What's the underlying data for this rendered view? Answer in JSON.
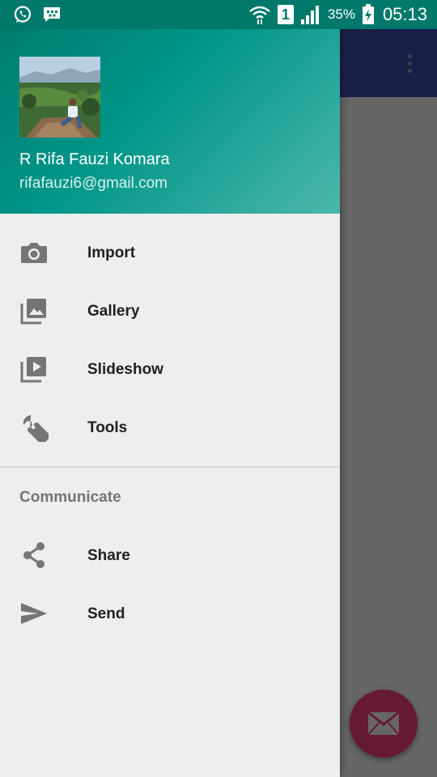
{
  "status_bar": {
    "battery_percent": "35%",
    "time": "05:13",
    "sim_slot": "1",
    "icons": [
      "whatsapp-icon",
      "bbm-icon",
      "wifi-icon",
      "sim-icon",
      "signal-icon",
      "battery-charging-icon"
    ]
  },
  "drawer": {
    "header": {
      "user_name": "R Rifa Fauzi Komara",
      "user_email": "rifafauzi6@gmail.com"
    },
    "items": [
      {
        "label": "Import",
        "icon": "camera-icon"
      },
      {
        "label": "Gallery",
        "icon": "gallery-icon"
      },
      {
        "label": "Slideshow",
        "icon": "slideshow-icon"
      },
      {
        "label": "Tools",
        "icon": "wrench-icon"
      }
    ],
    "section_title": "Communicate",
    "section_items": [
      {
        "label": "Share",
        "icon": "share-icon"
      },
      {
        "label": "Send",
        "icon": "send-icon"
      }
    ]
  },
  "fab": {
    "icon": "mail-icon"
  },
  "colors": {
    "header_start": "#00796B",
    "header_end": "#4DB6AC",
    "toolbar": "#3F51B5",
    "fab": "#FF4081",
    "drawer_bg": "#EEEEEE",
    "icon": "#757575"
  }
}
